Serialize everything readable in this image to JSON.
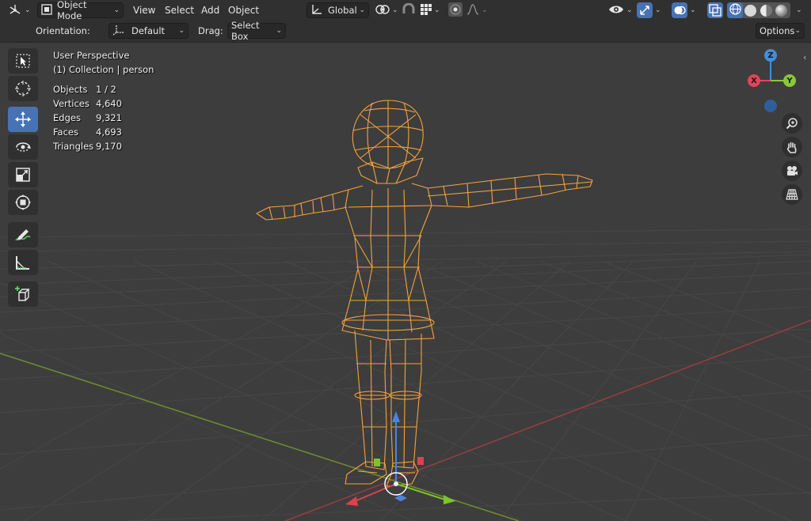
{
  "header": {
    "editor_type_icon": "3d-viewport-icon",
    "mode": {
      "label": "Object Mode",
      "icon": "object-mode-icon"
    },
    "menus": [
      "View",
      "Select",
      "Add",
      "Object"
    ],
    "transform_orientation": {
      "label": "Global",
      "icon": "global-orientation-icon"
    },
    "pivot_icon": "pivot-point-icon",
    "snap_icon": "snap-icon",
    "snap_target_icon": "snap-grid-icon",
    "proportional_icon": "proportional-edit-icon",
    "falloff_icon": "falloff-curve-icon",
    "visibility_icon": "eye-visibility-icon",
    "gizmo_icon": "gizmo-icon",
    "overlay_icon": "overlay-icon",
    "xray_icon": "xray-icon",
    "shading_modes": [
      "wireframe",
      "solid",
      "material-preview",
      "rendered"
    ],
    "active_shading": "wireframe"
  },
  "toolsettings": {
    "orientation_label": "Orientation:",
    "orientation_value": "Default",
    "drag_label": "Drag:",
    "drag_value": "Select Box",
    "options_label": "Options"
  },
  "tools": [
    {
      "name": "select-box-tool",
      "active": false
    },
    {
      "name": "cursor-tool",
      "active": false
    },
    {
      "name": "move-tool",
      "active": true
    },
    {
      "name": "rotate-tool",
      "active": false
    },
    {
      "name": "scale-tool",
      "active": false
    },
    {
      "name": "transform-tool",
      "active": false
    },
    {
      "name": "annotate-tool",
      "active": false
    },
    {
      "name": "measure-tool",
      "active": false
    },
    {
      "name": "add-cube-tool",
      "active": false
    }
  ],
  "viewport": {
    "view_name": "User Perspective",
    "collection": "(1) Collection | person",
    "stats": [
      {
        "label": "Objects",
        "value": "1 / 2"
      },
      {
        "label": "Vertices",
        "value": "4,640"
      },
      {
        "label": "Edges",
        "value": "9,321"
      },
      {
        "label": "Faces",
        "value": "4,693"
      },
      {
        "label": "Triangles",
        "value": "9,170"
      }
    ]
  },
  "nav_gizmo": {
    "x_label": "X",
    "y_label": "Y",
    "z_label": "Z",
    "x_color": "#e34458",
    "y_color": "#8ac73b",
    "z_color": "#3f8fe0"
  },
  "nav_buttons": [
    "zoom-icon",
    "hand-pan-icon",
    "camera-icon",
    "grid-perspective-icon"
  ],
  "colors": {
    "accent": "#4772b3",
    "selection": "#f5a23a",
    "background": "#3d3d3d",
    "header": "#303030"
  }
}
